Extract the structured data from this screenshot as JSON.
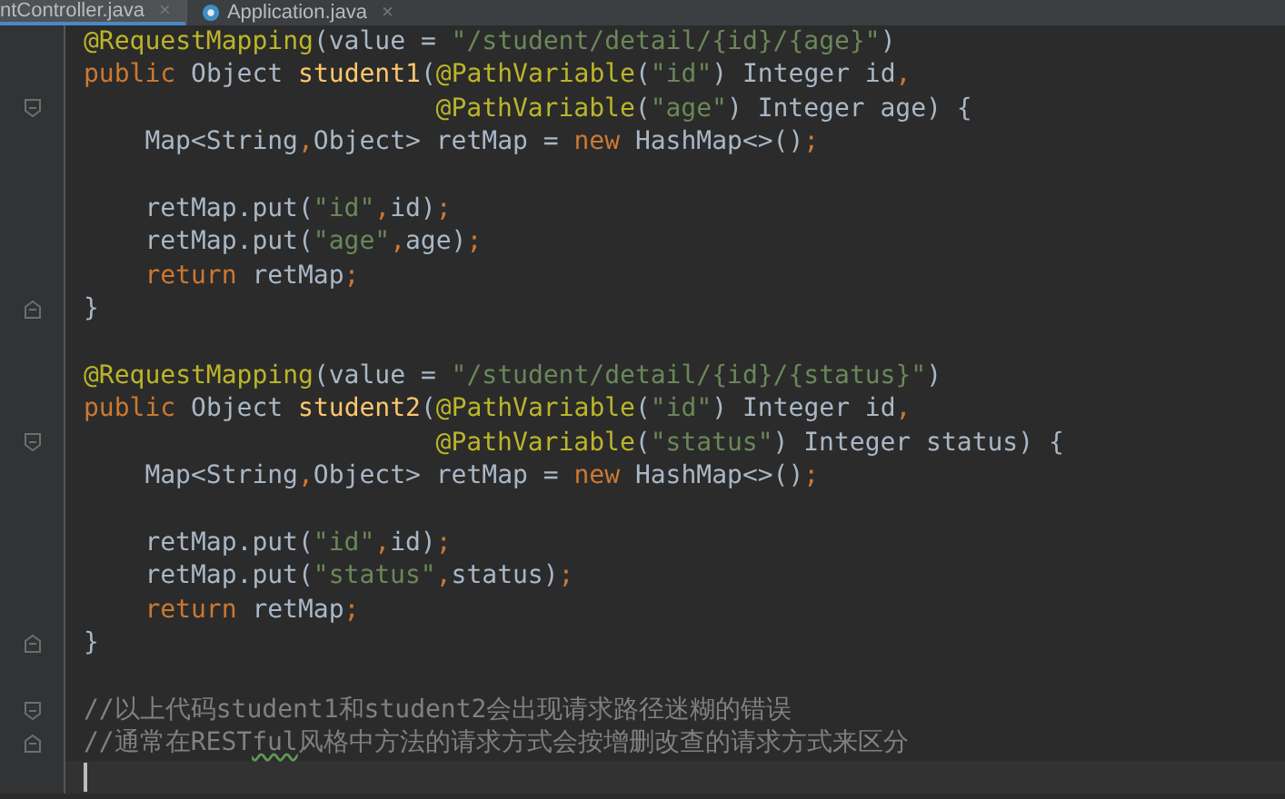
{
  "tabs": [
    {
      "label": "ntController.java",
      "close": "×",
      "selected": true,
      "icon": false
    },
    {
      "label": "Application.java",
      "close": "×",
      "selected": false,
      "icon": true
    }
  ],
  "lines": [
    {
      "kind": "top",
      "tokens": [
        {
          "text": "@RequestMapping",
          "kind": "annotation"
        },
        {
          "text": "(value = ",
          "kind": "plain"
        },
        {
          "text": "\"/student/detail/{id}/{age}\"",
          "kind": "string"
        },
        {
          "text": ")",
          "kind": "plain"
        }
      ]
    },
    {
      "kind": "top",
      "tokens": [
        {
          "text": "public ",
          "kind": "keyword"
        },
        {
          "text": "Object ",
          "kind": "plain"
        },
        {
          "text": "student1",
          "kind": "method"
        },
        {
          "text": "(",
          "kind": "plain"
        },
        {
          "text": "@PathVariable",
          "kind": "annotation"
        },
        {
          "text": "(",
          "kind": "plain"
        },
        {
          "text": "\"id\"",
          "kind": "string"
        },
        {
          "text": ") Integer id",
          "kind": "plain"
        },
        {
          "text": ",",
          "kind": "keyword"
        }
      ]
    },
    {
      "kind": "continuation",
      "fold_open": true,
      "tokens": [
        {
          "text": "@PathVariable",
          "kind": "annotation"
        },
        {
          "text": "(",
          "kind": "plain"
        },
        {
          "text": "\"age\"",
          "kind": "string"
        },
        {
          "text": ") Integer age) {",
          "kind": "plain"
        }
      ]
    },
    {
      "kind": "body",
      "tokens": [
        {
          "text": "Map<String",
          "kind": "plain"
        },
        {
          "text": ",",
          "kind": "keyword"
        },
        {
          "text": "Object> retMap = ",
          "kind": "plain"
        },
        {
          "text": "new ",
          "kind": "keyword"
        },
        {
          "text": "HashMap<>()",
          "kind": "plain"
        },
        {
          "text": ";",
          "kind": "keyword"
        }
      ]
    },
    {
      "kind": "blank"
    },
    {
      "kind": "body",
      "tokens": [
        {
          "text": "retMap.put(",
          "kind": "plain"
        },
        {
          "text": "\"id\"",
          "kind": "string"
        },
        {
          "text": ",",
          "kind": "keyword"
        },
        {
          "text": "id)",
          "kind": "plain"
        },
        {
          "text": ";",
          "kind": "keyword"
        }
      ]
    },
    {
      "kind": "body",
      "tokens": [
        {
          "text": "retMap.put(",
          "kind": "plain"
        },
        {
          "text": "\"age\"",
          "kind": "string"
        },
        {
          "text": ",",
          "kind": "keyword"
        },
        {
          "text": "age)",
          "kind": "plain"
        },
        {
          "text": ";",
          "kind": "keyword"
        }
      ]
    },
    {
      "kind": "body",
      "tokens": [
        {
          "text": "return ",
          "kind": "keyword"
        },
        {
          "text": "retMap",
          "kind": "plain"
        },
        {
          "text": ";",
          "kind": "keyword"
        }
      ]
    },
    {
      "kind": "top",
      "fold_close": true,
      "tokens": [
        {
          "text": "}",
          "kind": "plain"
        }
      ]
    },
    {
      "kind": "blank"
    },
    {
      "kind": "top",
      "tokens": [
        {
          "text": "@RequestMapping",
          "kind": "annotation"
        },
        {
          "text": "(value = ",
          "kind": "plain"
        },
        {
          "text": "\"/student/detail/{id}/{status}\"",
          "kind": "string"
        },
        {
          "text": ")",
          "kind": "plain"
        }
      ]
    },
    {
      "kind": "top",
      "tokens": [
        {
          "text": "public ",
          "kind": "keyword"
        },
        {
          "text": "Object ",
          "kind": "plain"
        },
        {
          "text": "student2",
          "kind": "method"
        },
        {
          "text": "(",
          "kind": "plain"
        },
        {
          "text": "@PathVariable",
          "kind": "annotation"
        },
        {
          "text": "(",
          "kind": "plain"
        },
        {
          "text": "\"id\"",
          "kind": "string"
        },
        {
          "text": ") Integer id",
          "kind": "plain"
        },
        {
          "text": ",",
          "kind": "keyword"
        }
      ]
    },
    {
      "kind": "continuation",
      "fold_open": true,
      "tokens": [
        {
          "text": "@PathVariable",
          "kind": "annotation"
        },
        {
          "text": "(",
          "kind": "plain"
        },
        {
          "text": "\"status\"",
          "kind": "string"
        },
        {
          "text": ") Integer status) {",
          "kind": "plain"
        }
      ]
    },
    {
      "kind": "body",
      "tokens": [
        {
          "text": "Map<String",
          "kind": "plain"
        },
        {
          "text": ",",
          "kind": "keyword"
        },
        {
          "text": "Object> retMap = ",
          "kind": "plain"
        },
        {
          "text": "new ",
          "kind": "keyword"
        },
        {
          "text": "HashMap<>()",
          "kind": "plain"
        },
        {
          "text": ";",
          "kind": "keyword"
        }
      ]
    },
    {
      "kind": "blank"
    },
    {
      "kind": "body",
      "tokens": [
        {
          "text": "retMap.put(",
          "kind": "plain"
        },
        {
          "text": "\"id\"",
          "kind": "string"
        },
        {
          "text": ",",
          "kind": "keyword"
        },
        {
          "text": "id)",
          "kind": "plain"
        },
        {
          "text": ";",
          "kind": "keyword"
        }
      ]
    },
    {
      "kind": "body",
      "tokens": [
        {
          "text": "retMap.put(",
          "kind": "plain"
        },
        {
          "text": "\"status\"",
          "kind": "string"
        },
        {
          "text": ",",
          "kind": "keyword"
        },
        {
          "text": "status)",
          "kind": "plain"
        },
        {
          "text": ";",
          "kind": "keyword"
        }
      ]
    },
    {
      "kind": "body",
      "tokens": [
        {
          "text": "return ",
          "kind": "keyword"
        },
        {
          "text": "retMap",
          "kind": "plain"
        },
        {
          "text": ";",
          "kind": "keyword"
        }
      ]
    },
    {
      "kind": "top",
      "fold_close": true,
      "tokens": [
        {
          "text": "}",
          "kind": "plain"
        }
      ]
    },
    {
      "kind": "blank"
    },
    {
      "kind": "top",
      "fold_open": true,
      "tokens": [
        {
          "text": "//以上代码student1和student2会出现请求路径迷糊的错误",
          "kind": "comment"
        }
      ]
    },
    {
      "kind": "top",
      "fold_close": true,
      "tokens": [
        {
          "text": "//通常在REST",
          "kind": "comment"
        },
        {
          "text": "ful",
          "kind": "typo"
        },
        {
          "text": "风格中方法的请求方式会按增删改查的请求方式来区分",
          "kind": "comment"
        }
      ]
    },
    {
      "kind": "top",
      "current": true
    }
  ]
}
